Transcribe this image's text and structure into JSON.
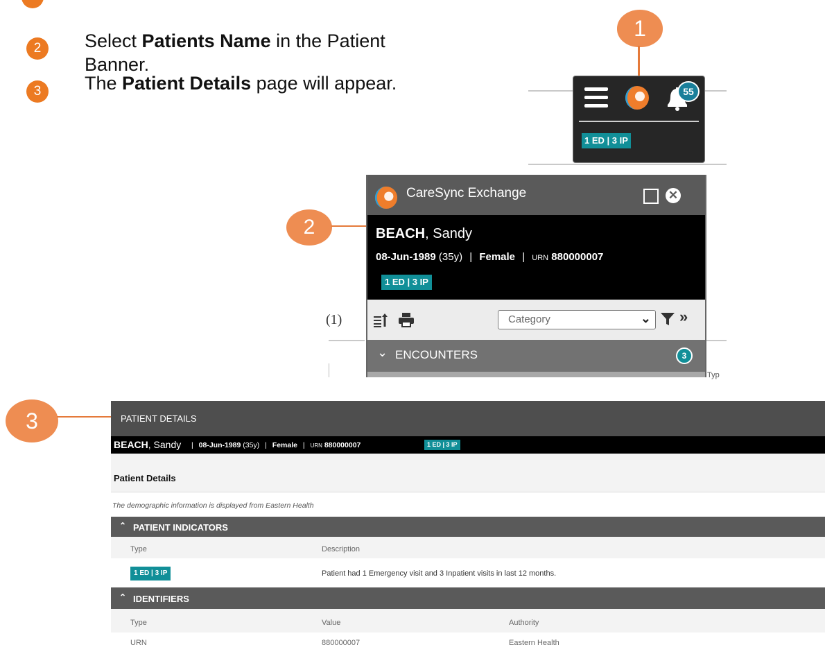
{
  "steps": [
    {
      "number": "2",
      "text_before": "Select ",
      "bold": "Patients Name",
      "text_after": " in the Patient Banner."
    },
    {
      "number": "3",
      "text_before": "The ",
      "bold": "Patient Details",
      "text_after": " page will appear."
    }
  ],
  "callouts": {
    "one": "1",
    "two": "2",
    "three": "3"
  },
  "toolbar": {
    "notification_count": "55",
    "visits_badge": "1 ED | 3 IP",
    "icons": [
      "menu-icon",
      "caresync-logo-icon",
      "bell-icon"
    ]
  },
  "caresync_panel": {
    "app_title": "CareSync Exchange",
    "patient_surname": "BEACH",
    "patient_given": ", Sandy",
    "dob": "08-Jun-1989",
    "age": "(35y)",
    "gender": "Female",
    "urn_label": "URN",
    "urn_value": "880000007",
    "visits_badge": "1 ED | 3 IP",
    "category_placeholder": "Category",
    "encounters_label": "ENCOUNTERS",
    "encounters_count": "3",
    "side_count": "(1)",
    "side_typ": "Typ"
  },
  "patient_details": {
    "screen_title": "PATIENT DETAILS",
    "banner": {
      "surname": "BEACH",
      "given": ", Sandy",
      "dob": "08-Jun-1989",
      "age": "(35y)",
      "gender": "Female",
      "urn_label": "URN",
      "urn_value": "880000007",
      "visits_badge": "1 ED | 3 IP"
    },
    "heading": "Patient Details",
    "note": "The demographic information is displayed from Eastern Health",
    "indicators": {
      "title": "PATIENT INDICATORS",
      "columns": [
        "Type",
        "Description"
      ],
      "row": {
        "type_badge": "1 ED | 3 IP",
        "description": "Patient had 1 Emergency visit and 3 Inpatient visits in last 12 months."
      }
    },
    "identifiers": {
      "title": "IDENTIFIERS",
      "columns": [
        "Type",
        "Value",
        "Authority"
      ],
      "row": {
        "type": "URN",
        "value": "880000007",
        "authority": "Eastern Health"
      }
    }
  },
  "colors": {
    "accent_orange": "#ec7a22",
    "teal_badge": "#118f98",
    "header_grey": "#5a5a5a"
  }
}
